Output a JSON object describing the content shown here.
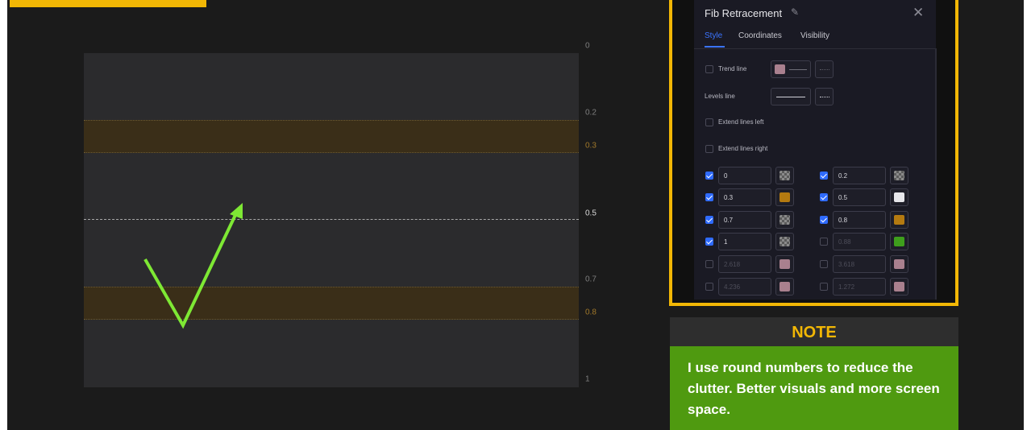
{
  "chart": {
    "level_labels": [
      "0",
      "0.2",
      "0.3",
      "0.5",
      "0.7",
      "0.8",
      "1"
    ]
  },
  "dialog": {
    "title": "Fib Retracement",
    "tabs": [
      "Style",
      "Coordinates",
      "Visibility"
    ],
    "options": {
      "trend_line": "Trend line",
      "levels_line": "Levels line",
      "extend_left": "Extend lines left",
      "extend_right": "Extend lines right"
    },
    "levels": [
      {
        "value": "0",
        "checked": true,
        "color": "checker"
      },
      {
        "value": "0.2",
        "checked": true,
        "color": "checker"
      },
      {
        "value": "0.3",
        "checked": true,
        "color": "#b47a10"
      },
      {
        "value": "0.5",
        "checked": true,
        "color": "#e6e6ea"
      },
      {
        "value": "0.7",
        "checked": true,
        "color": "checker"
      },
      {
        "value": "0.8",
        "checked": true,
        "color": "#b47a10"
      },
      {
        "value": "1",
        "checked": true,
        "color": "checker"
      },
      {
        "value": "0.88",
        "checked": false,
        "color": "#3e9e1c"
      },
      {
        "value": "2.618",
        "checked": false,
        "color": "#a9808e"
      },
      {
        "value": "3.618",
        "checked": false,
        "color": "#a9808e"
      },
      {
        "value": "4.236",
        "checked": false,
        "color": "#a9808e"
      },
      {
        "value": "1.272",
        "checked": false,
        "color": "#a9808e"
      }
    ]
  },
  "note": {
    "title": "NOTE",
    "text": "I use round numbers to reduce the clutter. Better visuals and more screen space."
  },
  "colors": {
    "accent_yellow": "#f2b705",
    "note_green": "#4f9a10",
    "check_green": "#7ee834",
    "band_orange": "#3a2e18",
    "active_blue": "#3b74ff"
  }
}
